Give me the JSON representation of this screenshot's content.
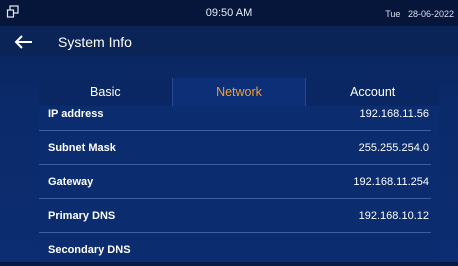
{
  "status": {
    "time": "09:50 AM",
    "day": "Tue",
    "date": "28-06-2022"
  },
  "header": {
    "title": "System Info"
  },
  "tabs": [
    {
      "label": "Basic"
    },
    {
      "label": "Network"
    },
    {
      "label": "Account"
    }
  ],
  "active_tab": "Network",
  "rows": [
    {
      "label": "IP address",
      "value": "192.168.11.56"
    },
    {
      "label": "Subnet Mask",
      "value": "255.255.254.0"
    },
    {
      "label": "Gateway",
      "value": "192.168.11.254"
    },
    {
      "label": "Primary DNS",
      "value": "192.168.10.12"
    },
    {
      "label": "Secondary DNS",
      "value": ""
    }
  ],
  "colors": {
    "background": "#0b2a6a",
    "accent": "#f0a030",
    "text": "#ffffff"
  }
}
